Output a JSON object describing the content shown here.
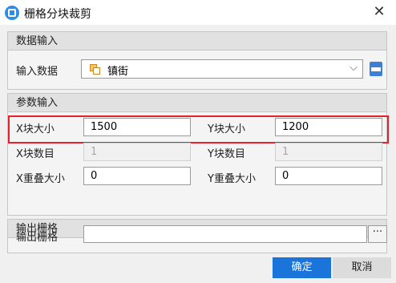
{
  "window": {
    "title": "栅格分块裁剪",
    "close": "✕"
  },
  "data_input": {
    "header": "数据输入",
    "label": "输入数据",
    "value": "镇街",
    "chevron": "⌵"
  },
  "param_input": {
    "header": "参数输入",
    "x_block_size_label": "X块大小",
    "x_block_size": "1500",
    "y_block_size_label": "Y块大小",
    "y_block_size": "1200",
    "x_block_count_label": "X块数目",
    "x_block_count": "1",
    "y_block_count_label": "Y块数目",
    "y_block_count": "1",
    "x_overlap_label": "X重叠大小",
    "x_overlap": "0",
    "y_overlap_label": "Y重叠大小",
    "y_overlap": "0"
  },
  "output": {
    "header": "输出栅格",
    "label": "输出栅格",
    "value": "",
    "browse": "···"
  },
  "buttons": {
    "ok": "确定",
    "cancel": "取消"
  },
  "colors": {
    "accent": "#1a74d9",
    "highlight": "#e8202a"
  },
  "icons": {
    "app": "app-icon",
    "dataset": "dataset-icon",
    "database": "database-icon"
  }
}
